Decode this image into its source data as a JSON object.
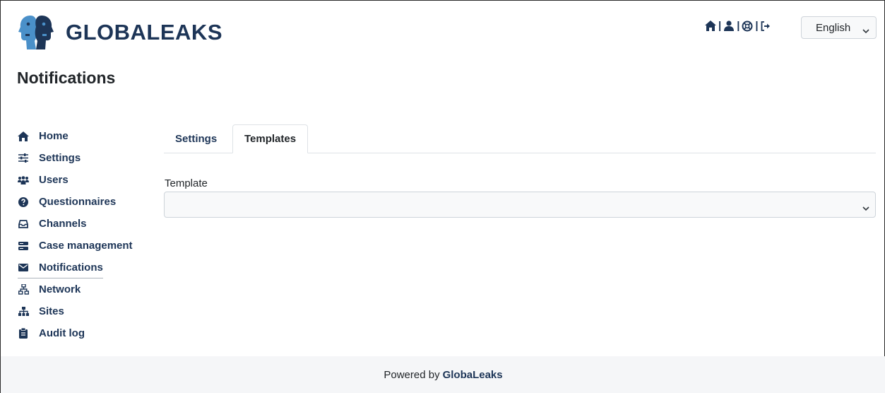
{
  "brand": {
    "name": "GLOBALEAKS"
  },
  "page": {
    "title": "Notifications"
  },
  "topnav": {
    "icons": [
      "home-icon",
      "user-icon",
      "support-icon",
      "logout-icon"
    ],
    "separator": "|"
  },
  "language": {
    "selected": "English"
  },
  "sidebar": {
    "items": [
      {
        "label": "Home",
        "icon": "home-icon"
      },
      {
        "label": "Settings",
        "icon": "sliders-icon"
      },
      {
        "label": "Users",
        "icon": "users-icon"
      },
      {
        "label": "Questionnaires",
        "icon": "question-icon"
      },
      {
        "label": "Channels",
        "icon": "inbox-icon"
      },
      {
        "label": "Case management",
        "icon": "server-icon"
      },
      {
        "label": "Notifications",
        "icon": "envelope-icon",
        "active": true
      },
      {
        "label": "Network",
        "icon": "network-icon"
      },
      {
        "label": "Sites",
        "icon": "sitemap-icon"
      },
      {
        "label": "Audit log",
        "icon": "clipboard-icon"
      }
    ]
  },
  "tabs": [
    {
      "label": "Settings"
    },
    {
      "label": "Templates",
      "active": true
    }
  ],
  "form": {
    "template_label": "Template",
    "template_value": ""
  },
  "footer": {
    "prefix": "Powered by",
    "brand": "GlobaLeaks"
  },
  "colors": {
    "accent": "#1d3557",
    "logo_light": "#4a90c9",
    "text": "#212529",
    "footer_bg": "#f5f6f8"
  }
}
